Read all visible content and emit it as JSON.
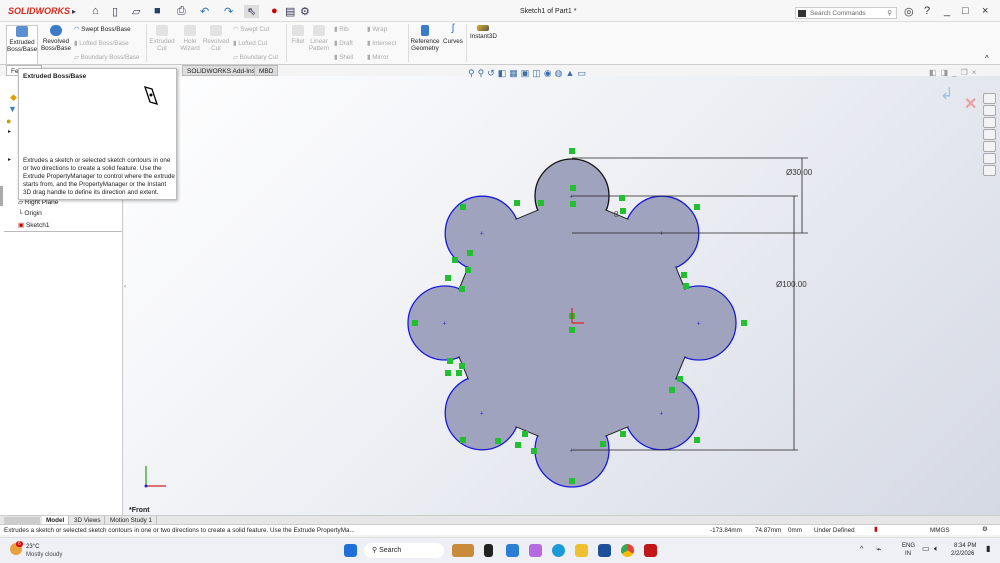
{
  "app": {
    "logo": "SOLIDWORKS",
    "title": "Sketch1 of Part1 *",
    "search_placeholder": "Search Commands"
  },
  "ribbon": {
    "extruded_boss": "Extruded Boss/Base",
    "revolved_boss": "Revolved Boss/Base",
    "swept_boss": "Swept Boss/Base",
    "lofted_boss": "Lofted Boss/Base",
    "boundary_boss": "Boundary Boss/Base",
    "extruded_cut": "Extruded Cut",
    "hole_wizard": "Hole Wizard",
    "revolved_cut": "Revolved Cut",
    "swept_cut": "Swept Cut",
    "lofted_cut": "Lofted Cut",
    "boundary_cut": "Boundary Cut",
    "fillet": "Fillet",
    "linear_pattern": "Linear Pattern",
    "rib": "Rib",
    "draft": "Draft",
    "shell": "Shell",
    "wrap": "Wrap",
    "intersect": "Intersect",
    "mirror": "Mirror",
    "reference_geometry": "Reference Geometry",
    "curves": "Curves",
    "instant3d": "Instant3D"
  },
  "tabs": [
    "Features",
    "SOLIDWORKS Add-Ins",
    "MBD"
  ],
  "tooltip": {
    "title": "Extruded Boss/Base",
    "description": "Extrudes a sketch or selected sketch contours in one or two directions to create a solid feature. Use the Extrude PropertyManager to control where the extrude starts from, and the PropertyManager or the Instant 3D drag handle to define its direction and extent."
  },
  "tree": [
    "Right Plane",
    "Origin",
    "Sketch1"
  ],
  "sketch": {
    "dim_small": "Ø30.00",
    "dim_large": "Ø100.00",
    "label_8": "8",
    "view_name": "*Front",
    "line_color": "#1a1adb",
    "fill_color": "#9fa3bd"
  },
  "bottom_tabs": [
    "Model",
    "3D Views",
    "Motion Study 1"
  ],
  "status": {
    "message": "Extrudes a sketch or selected sketch contours in one or two directions to create a solid feature. Use the Extrude PropertyMa...",
    "x": "-173.84mm",
    "y": "74.87mm",
    "z": "0mm",
    "state": "Under Defined",
    "units": "MMGS"
  },
  "taskbar": {
    "temp": "23°C",
    "weather": "Mostly cloudy",
    "search": "Search",
    "lang1": "ENG",
    "lang2": "IN",
    "time": "8:34 PM",
    "date": "2/2/2026",
    "badge": "6"
  }
}
